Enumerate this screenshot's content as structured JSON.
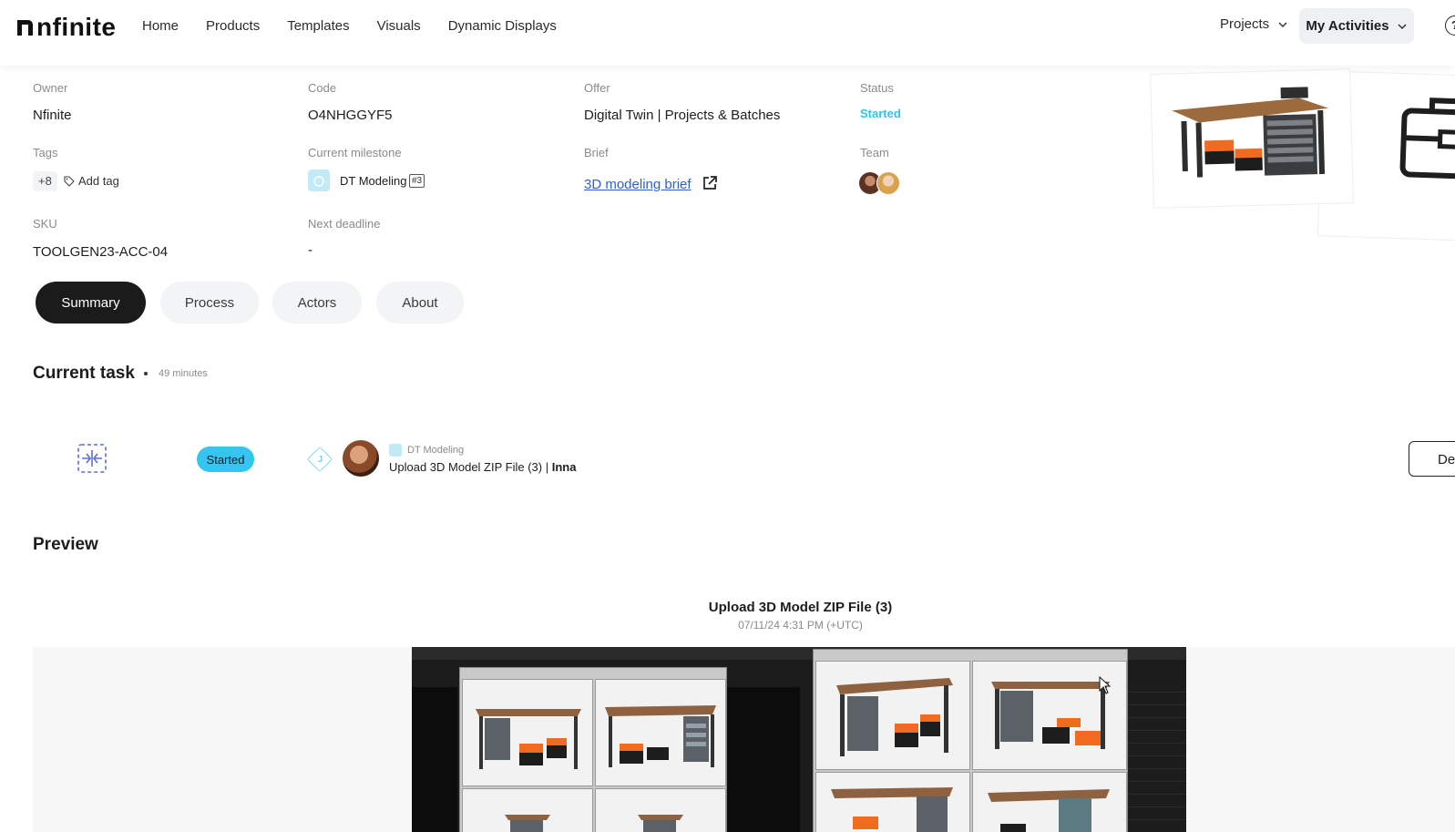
{
  "brand": {
    "name": "nfinite"
  },
  "nav": {
    "items": [
      "Home",
      "Products",
      "Templates",
      "Visuals",
      "Dynamic Displays"
    ],
    "projects": "Projects",
    "my_activities": "My Activities"
  },
  "info": {
    "owner": {
      "label": "Owner",
      "value": "Nfinite"
    },
    "code": {
      "label": "Code",
      "value": "O4NHGGYF5"
    },
    "offer": {
      "label": "Offer",
      "value": "Digital Twin | Projects & Batches"
    },
    "status": {
      "label": "Status",
      "value": "Started"
    },
    "tags": {
      "label": "Tags",
      "count": "+8",
      "add": "Add tag"
    },
    "milestone": {
      "label": "Current milestone",
      "value": "DT Modeling",
      "number": "#3"
    },
    "brief": {
      "label": "Brief",
      "link": "3D modeling brief"
    },
    "team": {
      "label": "Team"
    },
    "sku": {
      "label": "SKU",
      "value": "TOOLGEN23-ACC-04"
    },
    "deadline": {
      "label": "Next deadline",
      "value": "-"
    }
  },
  "tabs": [
    "Summary",
    "Process",
    "Actors",
    "About"
  ],
  "current_task": {
    "heading": "Current task",
    "duration": "49 minutes",
    "status": "Started",
    "assignee_initial": "J",
    "milestone": "DT Modeling",
    "title": "Upload 3D Model ZIP File (3) | ",
    "assignee": "Inna",
    "details_button": "Det"
  },
  "preview": {
    "heading": "Preview",
    "file_title": "Upload 3D Model ZIP File (3)",
    "timestamp": "07/11/24 4:31 PM (+UTC)"
  },
  "colors": {
    "accent": "#36c5f0",
    "link": "#2d5fd7",
    "dark": "#1b1b1b"
  }
}
